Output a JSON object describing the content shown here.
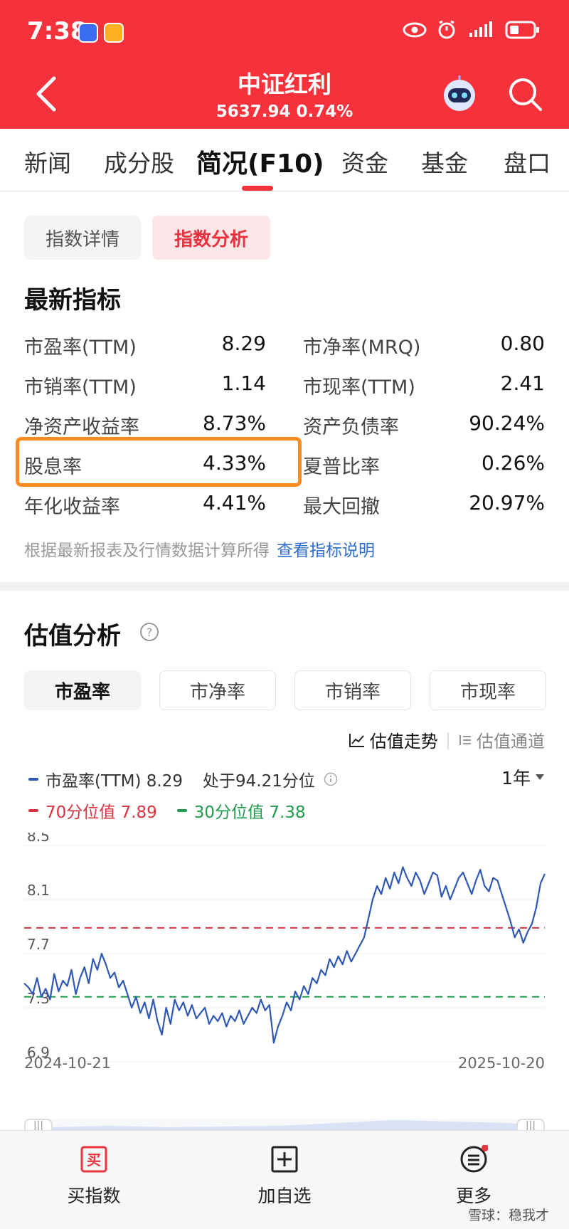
{
  "status_bar": {
    "time": "7:38",
    "battery_icon": "battery-icon",
    "signal_icon": "signal-icon"
  },
  "header": {
    "title": "中证红利",
    "subtitle": "5637.94 0.74%"
  },
  "tabs": [
    {
      "label": "新闻"
    },
    {
      "label": "成分股"
    },
    {
      "label": "简况(F10)",
      "active": true
    },
    {
      "label": "资金"
    },
    {
      "label": "基金"
    },
    {
      "label": "盘口"
    }
  ],
  "subtabs": {
    "details": "指数详情",
    "analysis": "指数分析"
  },
  "latest": {
    "title": "最新指标",
    "metrics": [
      {
        "label": "市盈率(TTM)",
        "value": "8.29"
      },
      {
        "label": "市净率(MRQ)",
        "value": "0.80"
      },
      {
        "label": "市销率(TTM)",
        "value": "1.14"
      },
      {
        "label": "市现率(TTM)",
        "value": "2.41"
      },
      {
        "label": "净资产收益率",
        "value": "8.73%"
      },
      {
        "label": "资产负债率",
        "value": "90.24%"
      },
      {
        "label": "股息率",
        "value": "4.33%"
      },
      {
        "label": "夏普比率",
        "value": "0.26%"
      },
      {
        "label": "年化收益率",
        "value": "4.41%"
      },
      {
        "label": "最大回撤",
        "value": "20.97%"
      }
    ],
    "note": "根据最新报表及行情数据计算所得",
    "note_link": "查看指标说明"
  },
  "valuation": {
    "title": "估值分析",
    "tabs": [
      "市盈率",
      "市净率",
      "市销率",
      "市现率"
    ],
    "view_trend": "估值走势",
    "view_channel": "估值通道",
    "legend_main": "市盈率(TTM) 8.29",
    "legend_percentile": "处于94.21分位",
    "legend_p70": "70分位值 7.89",
    "legend_p30": "30分位值 7.38",
    "period": "1年",
    "x_start": "2024-10-21",
    "x_end": "2025-10-20"
  },
  "chart_data": {
    "type": "line",
    "yticks": [
      "8.5",
      "8.1",
      "7.7",
      "7.3",
      "6.9"
    ],
    "ylim": [
      6.9,
      8.5
    ],
    "xlim": [
      "2024-10-21",
      "2025-10-20"
    ],
    "reference_lines": [
      {
        "value": 7.89,
        "color": "#d9333f"
      },
      {
        "value": 7.38,
        "color": "#1e9b4d"
      }
    ],
    "series": [
      {
        "color": "#2f57b5",
        "values": [
          7.48,
          7.45,
          7.4,
          7.52,
          7.38,
          7.44,
          7.36,
          7.55,
          7.42,
          7.5,
          7.46,
          7.58,
          7.4,
          7.52,
          7.6,
          7.48,
          7.66,
          7.58,
          7.7,
          7.62,
          7.52,
          7.56,
          7.45,
          7.5,
          7.4,
          7.3,
          7.38,
          7.26,
          7.34,
          7.22,
          7.36,
          7.2,
          7.1,
          7.3,
          7.18,
          7.36,
          7.28,
          7.34,
          7.24,
          7.32,
          7.22,
          7.26,
          7.3,
          7.18,
          7.24,
          7.2,
          7.26,
          7.16,
          7.24,
          7.2,
          7.28,
          7.18,
          7.24,
          7.3,
          7.26,
          7.36,
          7.28,
          7.32,
          7.04,
          7.16,
          7.24,
          7.34,
          7.28,
          7.42,
          7.36,
          7.46,
          7.4,
          7.52,
          7.48,
          7.58,
          7.54,
          7.66,
          7.6,
          7.68,
          7.62,
          7.72,
          7.64,
          7.7,
          7.76,
          7.82,
          7.96,
          8.1,
          8.2,
          8.14,
          8.26,
          8.18,
          8.3,
          8.22,
          8.34,
          8.26,
          8.2,
          8.3,
          8.24,
          8.14,
          8.22,
          8.3,
          8.28,
          8.12,
          8.2,
          8.1,
          8.18,
          8.26,
          8.3,
          8.22,
          8.14,
          8.24,
          8.32,
          8.2,
          8.16,
          8.26,
          8.24,
          8.14,
          8.04,
          7.94,
          7.82,
          7.88,
          7.78,
          7.86,
          7.92,
          8.04,
          8.22,
          8.29
        ]
      }
    ]
  },
  "bottom_nav": {
    "buy": "买指数",
    "add": "加自选",
    "more": "更多"
  },
  "watermark": "雪球：稳我才"
}
